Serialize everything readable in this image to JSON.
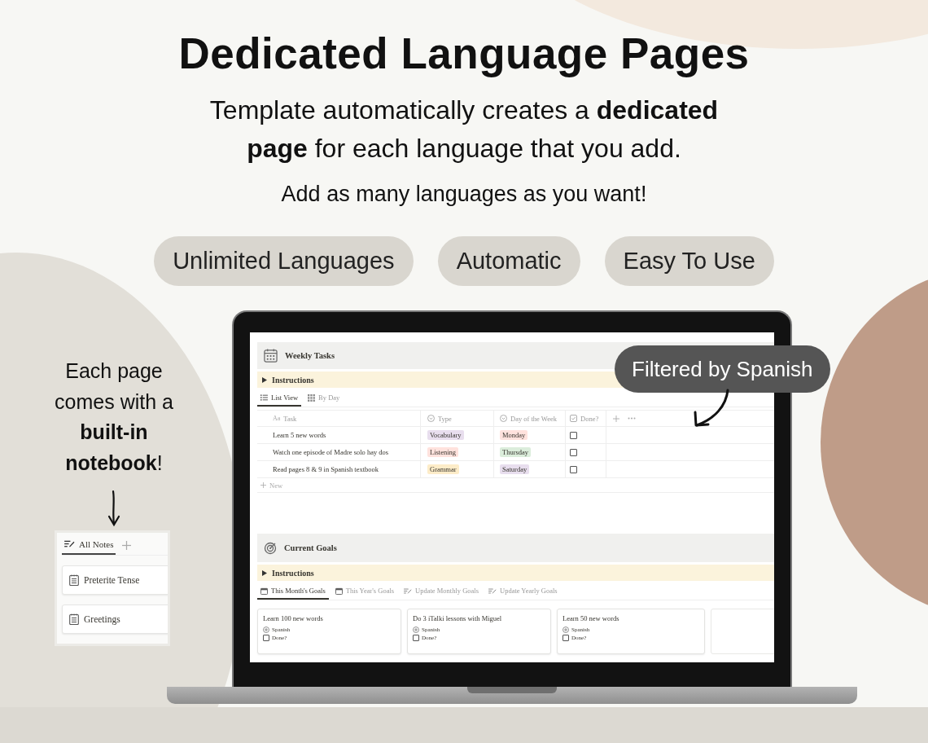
{
  "headline": "Dedicated Language Pages",
  "subtitle": "Template automatically creates a **dedicated page** for each language that you add.",
  "tagline": "Add as many languages as you want!",
  "feature_pills": [
    "Unlimited Languages",
    "Automatic",
    "Easy To Use"
  ],
  "notebook_callout": "Each page comes with a **built-in notebook**!",
  "notebook": {
    "tabs": [
      {
        "label": "All Notes",
        "selected": true
      }
    ],
    "notes": [
      "Preterite Tense",
      "Greetings"
    ]
  },
  "filter_callout": "Filtered by Spanish",
  "laptop_screen": {
    "weekly_tasks": {
      "title": "Weekly Tasks",
      "toggle": "Instructions",
      "views": [
        {
          "label": "List View",
          "kind": "list",
          "selected": true
        },
        {
          "label": "By Day",
          "kind": "grid",
          "selected": false
        }
      ],
      "columns": [
        {
          "label": "Task",
          "kind": "title",
          "type_mark": "Aa"
        },
        {
          "label": "Type",
          "kind": "select"
        },
        {
          "label": "Day of the Week",
          "kind": "select"
        },
        {
          "label": "Done?",
          "kind": "checkbox"
        }
      ],
      "rows": [
        {
          "task": "Learn 5 new words",
          "type": {
            "label": "Vocabulary",
            "color": "#e8deee"
          },
          "day": {
            "label": "Monday",
            "color": "#ffe2dd"
          },
          "done": false
        },
        {
          "task": "Watch one episode of Madre solo hay dos",
          "type": {
            "label": "Listening",
            "color": "#ffe2dd"
          },
          "day": {
            "label": "Thursday",
            "color": "#dbeddb"
          },
          "done": false
        },
        {
          "task": "Read pages 8 & 9 in Spanish textbook",
          "type": {
            "label": "Grammar",
            "color": "#fdecc8"
          },
          "day": {
            "label": "Saturday",
            "color": "#e8deee"
          },
          "done": false
        }
      ],
      "new_row": "New"
    },
    "current_goals": {
      "title": "Current Goals",
      "toggle": "Instructions",
      "views": [
        {
          "label": "This Month's Goals",
          "kind": "calendar",
          "selected": true
        },
        {
          "label": "This Year's Goals",
          "kind": "calendar",
          "selected": false
        },
        {
          "label": "Update Monthly Goals",
          "kind": "edit",
          "selected": false
        },
        {
          "label": "Update Yearly Goals",
          "kind": "edit",
          "selected": false
        }
      ],
      "cards": [
        {
          "title": "Learn 100 new words",
          "language": "Spanish",
          "done_label": "Done?",
          "done": false
        },
        {
          "title": "Do 3 iTalki lessons with Miguel",
          "language": "Spanish",
          "done_label": "Done?",
          "done": false
        },
        {
          "title": "Learn 50 new words",
          "language": "Spanish",
          "done_label": "Done?",
          "done": false
        }
      ]
    }
  }
}
